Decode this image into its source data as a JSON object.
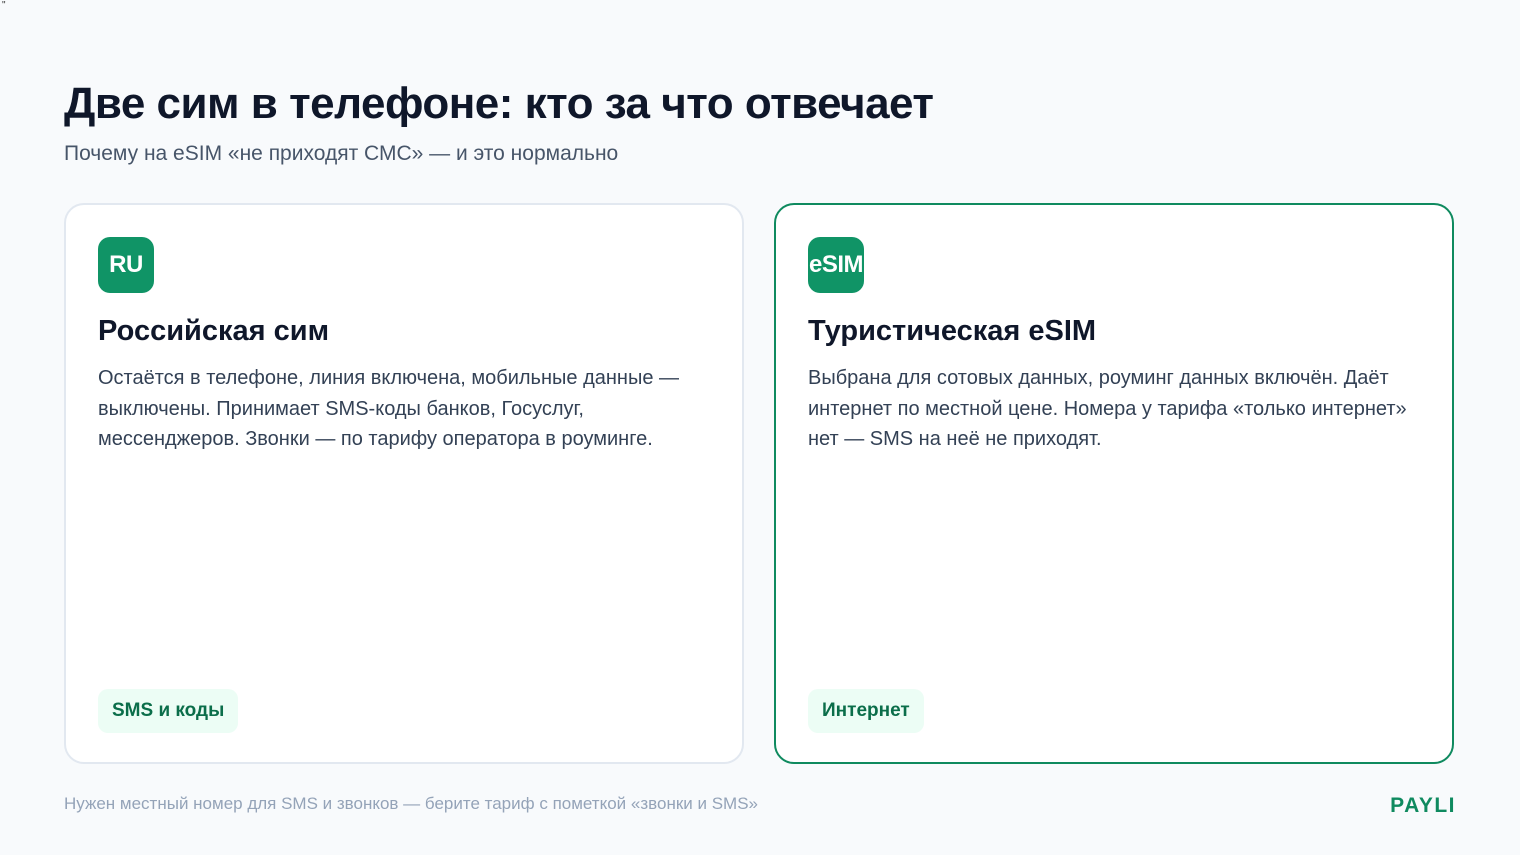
{
  "stray_mark": "\"",
  "header": {
    "title": "Две сим в телефоне: кто за что отвечает",
    "subtitle": "Почему на eSIM «не приходят СМС» — и это нормально"
  },
  "cards": [
    {
      "badge": "RU",
      "title": "Российская сим",
      "text": "Остаётся в телефоне, линия включена, мобильные данные — выключены. Принимает SMS-коды банков, Госуслуг, мессенджеров. Звонки — по тарифу оператора в роуминге.",
      "chip": "SMS и коды"
    },
    {
      "badge": "eSIM",
      "title": "Туристическая eSIM",
      "text": "Выбрана для сотовых данных, роуминг данных включён. Даёт интернет по местной цене. Номера у тарифа «только интернет» нет — SMS на неё не приходят.",
      "chip": "Интернет"
    }
  ],
  "footer": {
    "note": "Нужен местный номер для SMS и звонков — берите тариф с пометкой «звонки и SMS»",
    "brand": "PAYLI"
  },
  "colors": {
    "accent": "#0f8a5f",
    "badge_bg": "#109466",
    "chip_bg": "#ecfdf5",
    "background": "#f8fafc"
  }
}
